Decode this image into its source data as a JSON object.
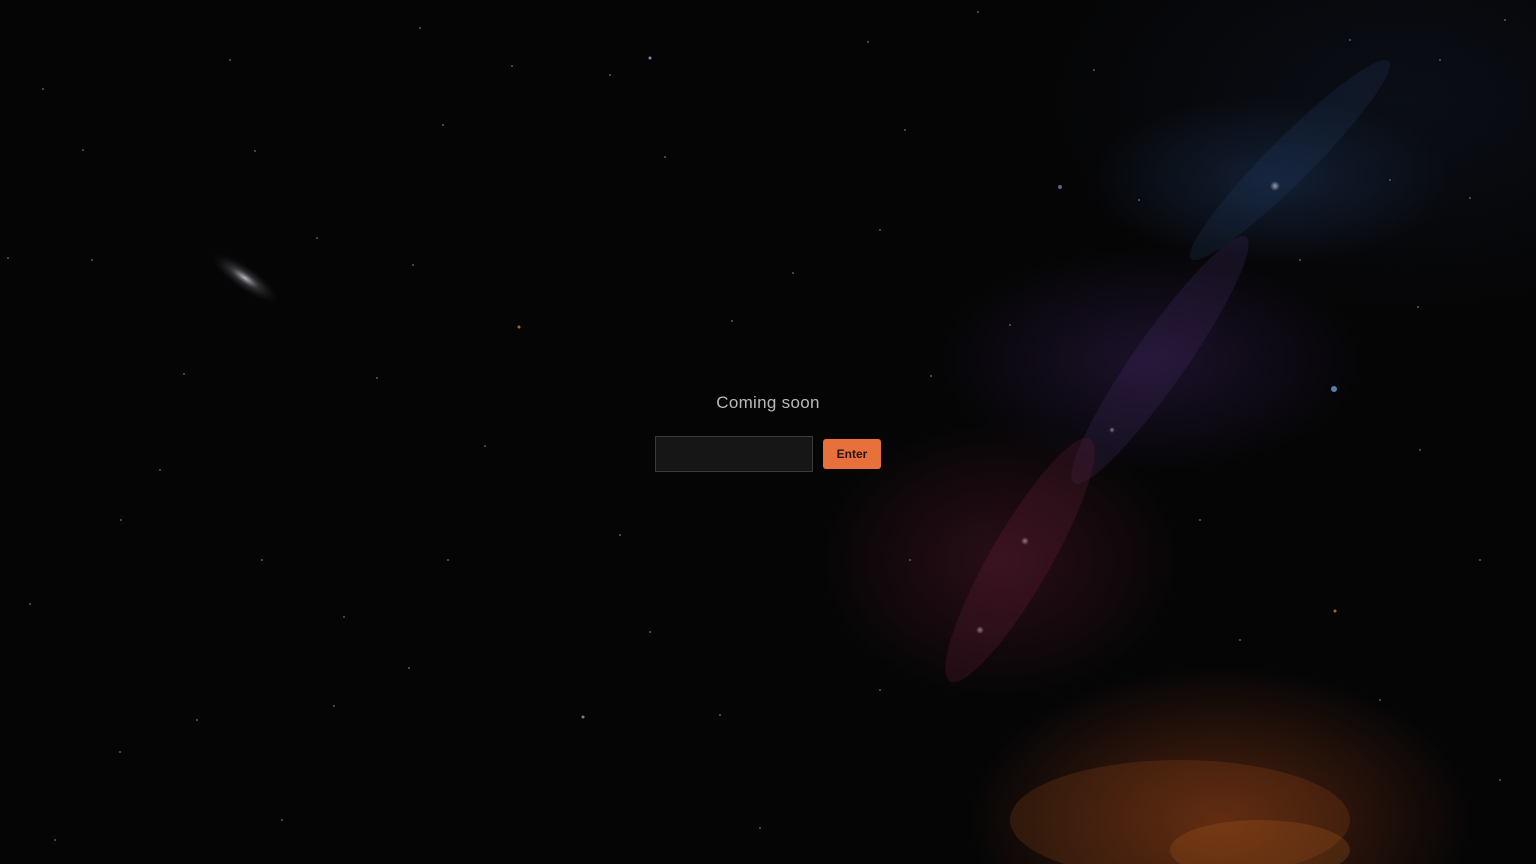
{
  "page": {
    "title": "Coming soon"
  },
  "form": {
    "input_value": "",
    "input_placeholder": "",
    "enter_label": "Enter"
  },
  "theme": {
    "accent": "#e8703a",
    "background": "#050506",
    "text": "#b9b9b9"
  }
}
